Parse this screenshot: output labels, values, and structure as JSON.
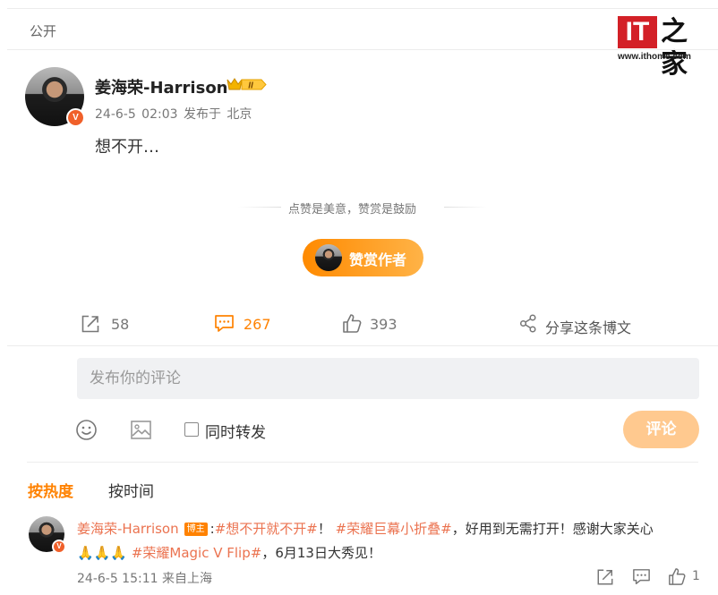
{
  "post": {
    "visibility": "公开",
    "author": "姜海荣-Harrison",
    "level_badge": "II",
    "verified_mark": "V",
    "meta": "24-6-5 02:03  发布于 北京",
    "content": "想不开…",
    "reward_tip": "点赞是美意，赞赏是鼓励",
    "reward_button": "赞赏作者"
  },
  "watermark": {
    "logo": "IT",
    "logo_cn": "之家",
    "url": "www.ithome.com"
  },
  "actions": {
    "repost_count": "58",
    "comment_count": "267",
    "like_count": "393",
    "share_label": "分享这条博文"
  },
  "composer": {
    "placeholder": "发布你的评论",
    "repost_label": "同时转发",
    "submit_label": "评论"
  },
  "sort": {
    "hot": "按热度",
    "time": "按时间"
  },
  "comment": {
    "author": "姜海荣-Harrison",
    "badge": "博主",
    "colon": ":",
    "tag1": "#想不开就不开#",
    "sep1": "！ ",
    "tag2": "#荣耀巨幕小折叠#",
    "text1": "，好用到无需打开！感谢大家关心",
    "emoji": "🙏🙏🙏",
    "tag3": "#荣耀Magic V Flip#",
    "text2": "，6月13日大秀见！",
    "meta": "24-6-5 15:11  来自上海",
    "like_count": "1"
  },
  "colors": {
    "accent": "#ff8200",
    "link": "#eb7350",
    "verified": "#f0602a"
  }
}
